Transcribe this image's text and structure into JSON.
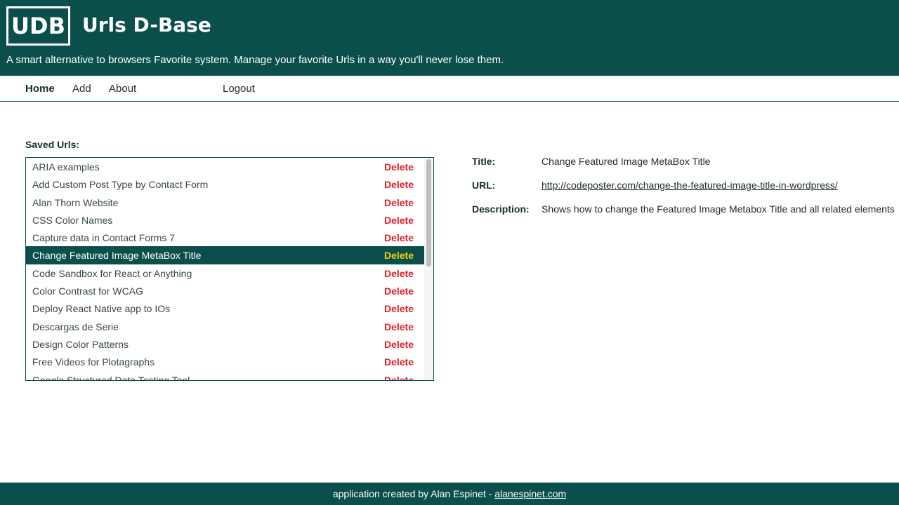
{
  "header": {
    "logo_text": "UDB",
    "title": "Urls D-Base",
    "tagline": "A smart alternative to browsers Favorite system. Manage your favorite Urls in a way you'll never lose them.",
    "background_color": "#0b4f4c"
  },
  "nav": {
    "items": [
      {
        "label": "Home",
        "active": true
      },
      {
        "label": "Add",
        "active": false
      },
      {
        "label": "About",
        "active": false
      },
      {
        "label": "Logout",
        "active": false
      }
    ]
  },
  "saved": {
    "label": "Saved Urls:",
    "delete_label": "Delete",
    "items": [
      {
        "title": "ARIA examples"
      },
      {
        "title": "Add Custom Post Type by Contact Form"
      },
      {
        "title": "Alan Thorn Website"
      },
      {
        "title": "CSS Color Names"
      },
      {
        "title": "Capture data in Contact Forms 7"
      },
      {
        "title": "Change Featured Image MetaBox Title",
        "selected": true
      },
      {
        "title": "Code Sandbox for React or Anything"
      },
      {
        "title": "Color Contrast for WCAG"
      },
      {
        "title": "Deploy React Native app to IOs"
      },
      {
        "title": "Descargas de Serie"
      },
      {
        "title": "Design Color Patterns"
      },
      {
        "title": "Free Videos for Plotagraphs"
      },
      {
        "title": "Google Structured Data Testing Tool"
      }
    ],
    "selected_color": "#0b4f4c",
    "delete_color": "#e0202a",
    "selected_delete_color": "#f5d10a"
  },
  "detail": {
    "title_label": "Title:",
    "title_value": "Change Featured Image MetaBox Title",
    "url_label": "URL:",
    "url_value": "http://codeposter.com/change-the-featured-image-title-in-wordpress/",
    "description_label": "Description:",
    "description_value": "Shows how to change the Featured Image Metabox Title and all related elements"
  },
  "footer": {
    "text": "application created by Alan Espinet - ",
    "link": "alanespinet.com"
  }
}
